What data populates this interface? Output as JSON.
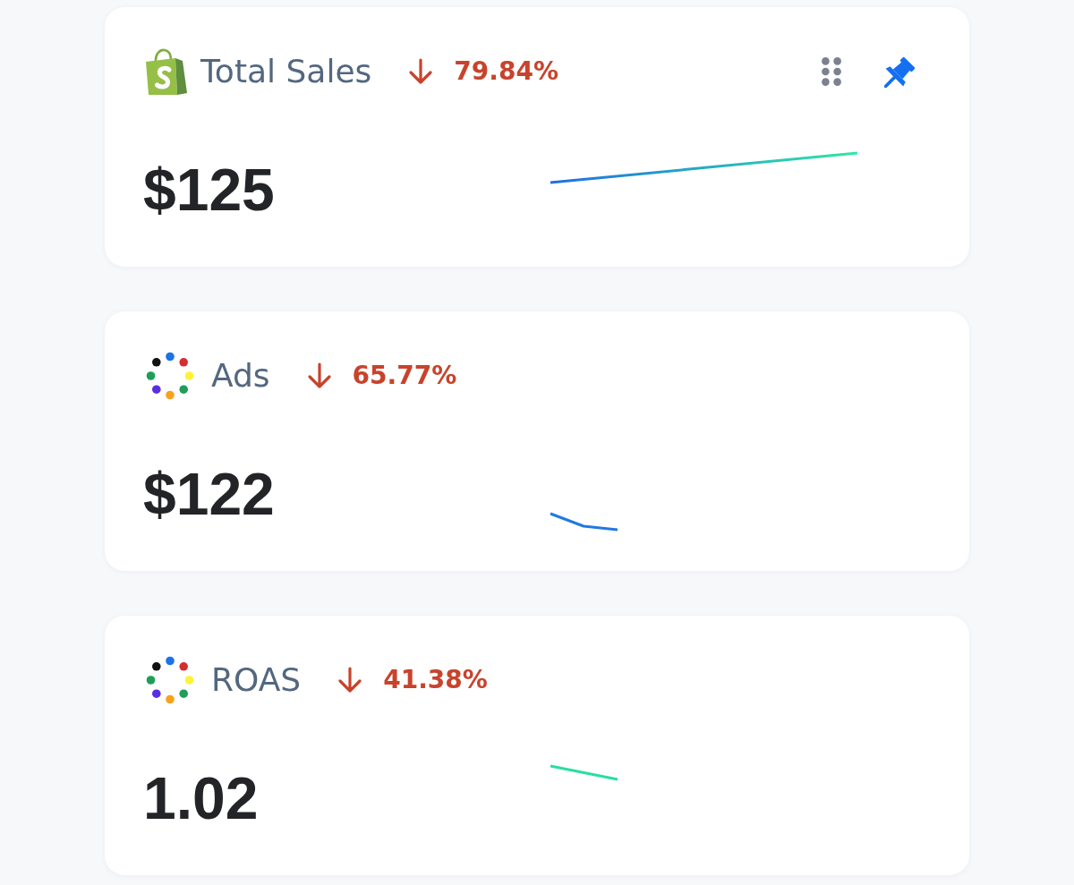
{
  "cards": [
    {
      "kind": "shop",
      "title": "Total Sales",
      "change": {
        "negative": true,
        "value": "79.84%"
      },
      "value": "$125",
      "pinned": true
    },
    {
      "kind": "ads",
      "title": "Ads",
      "change": {
        "negative": true,
        "value": "65.77%"
      },
      "value": "$122",
      "pinned": false
    },
    {
      "kind": "ads",
      "title": "ROAS",
      "change": {
        "negative": true,
        "value": "41.38%"
      },
      "value": "1.02",
      "pinned": false
    }
  ]
}
